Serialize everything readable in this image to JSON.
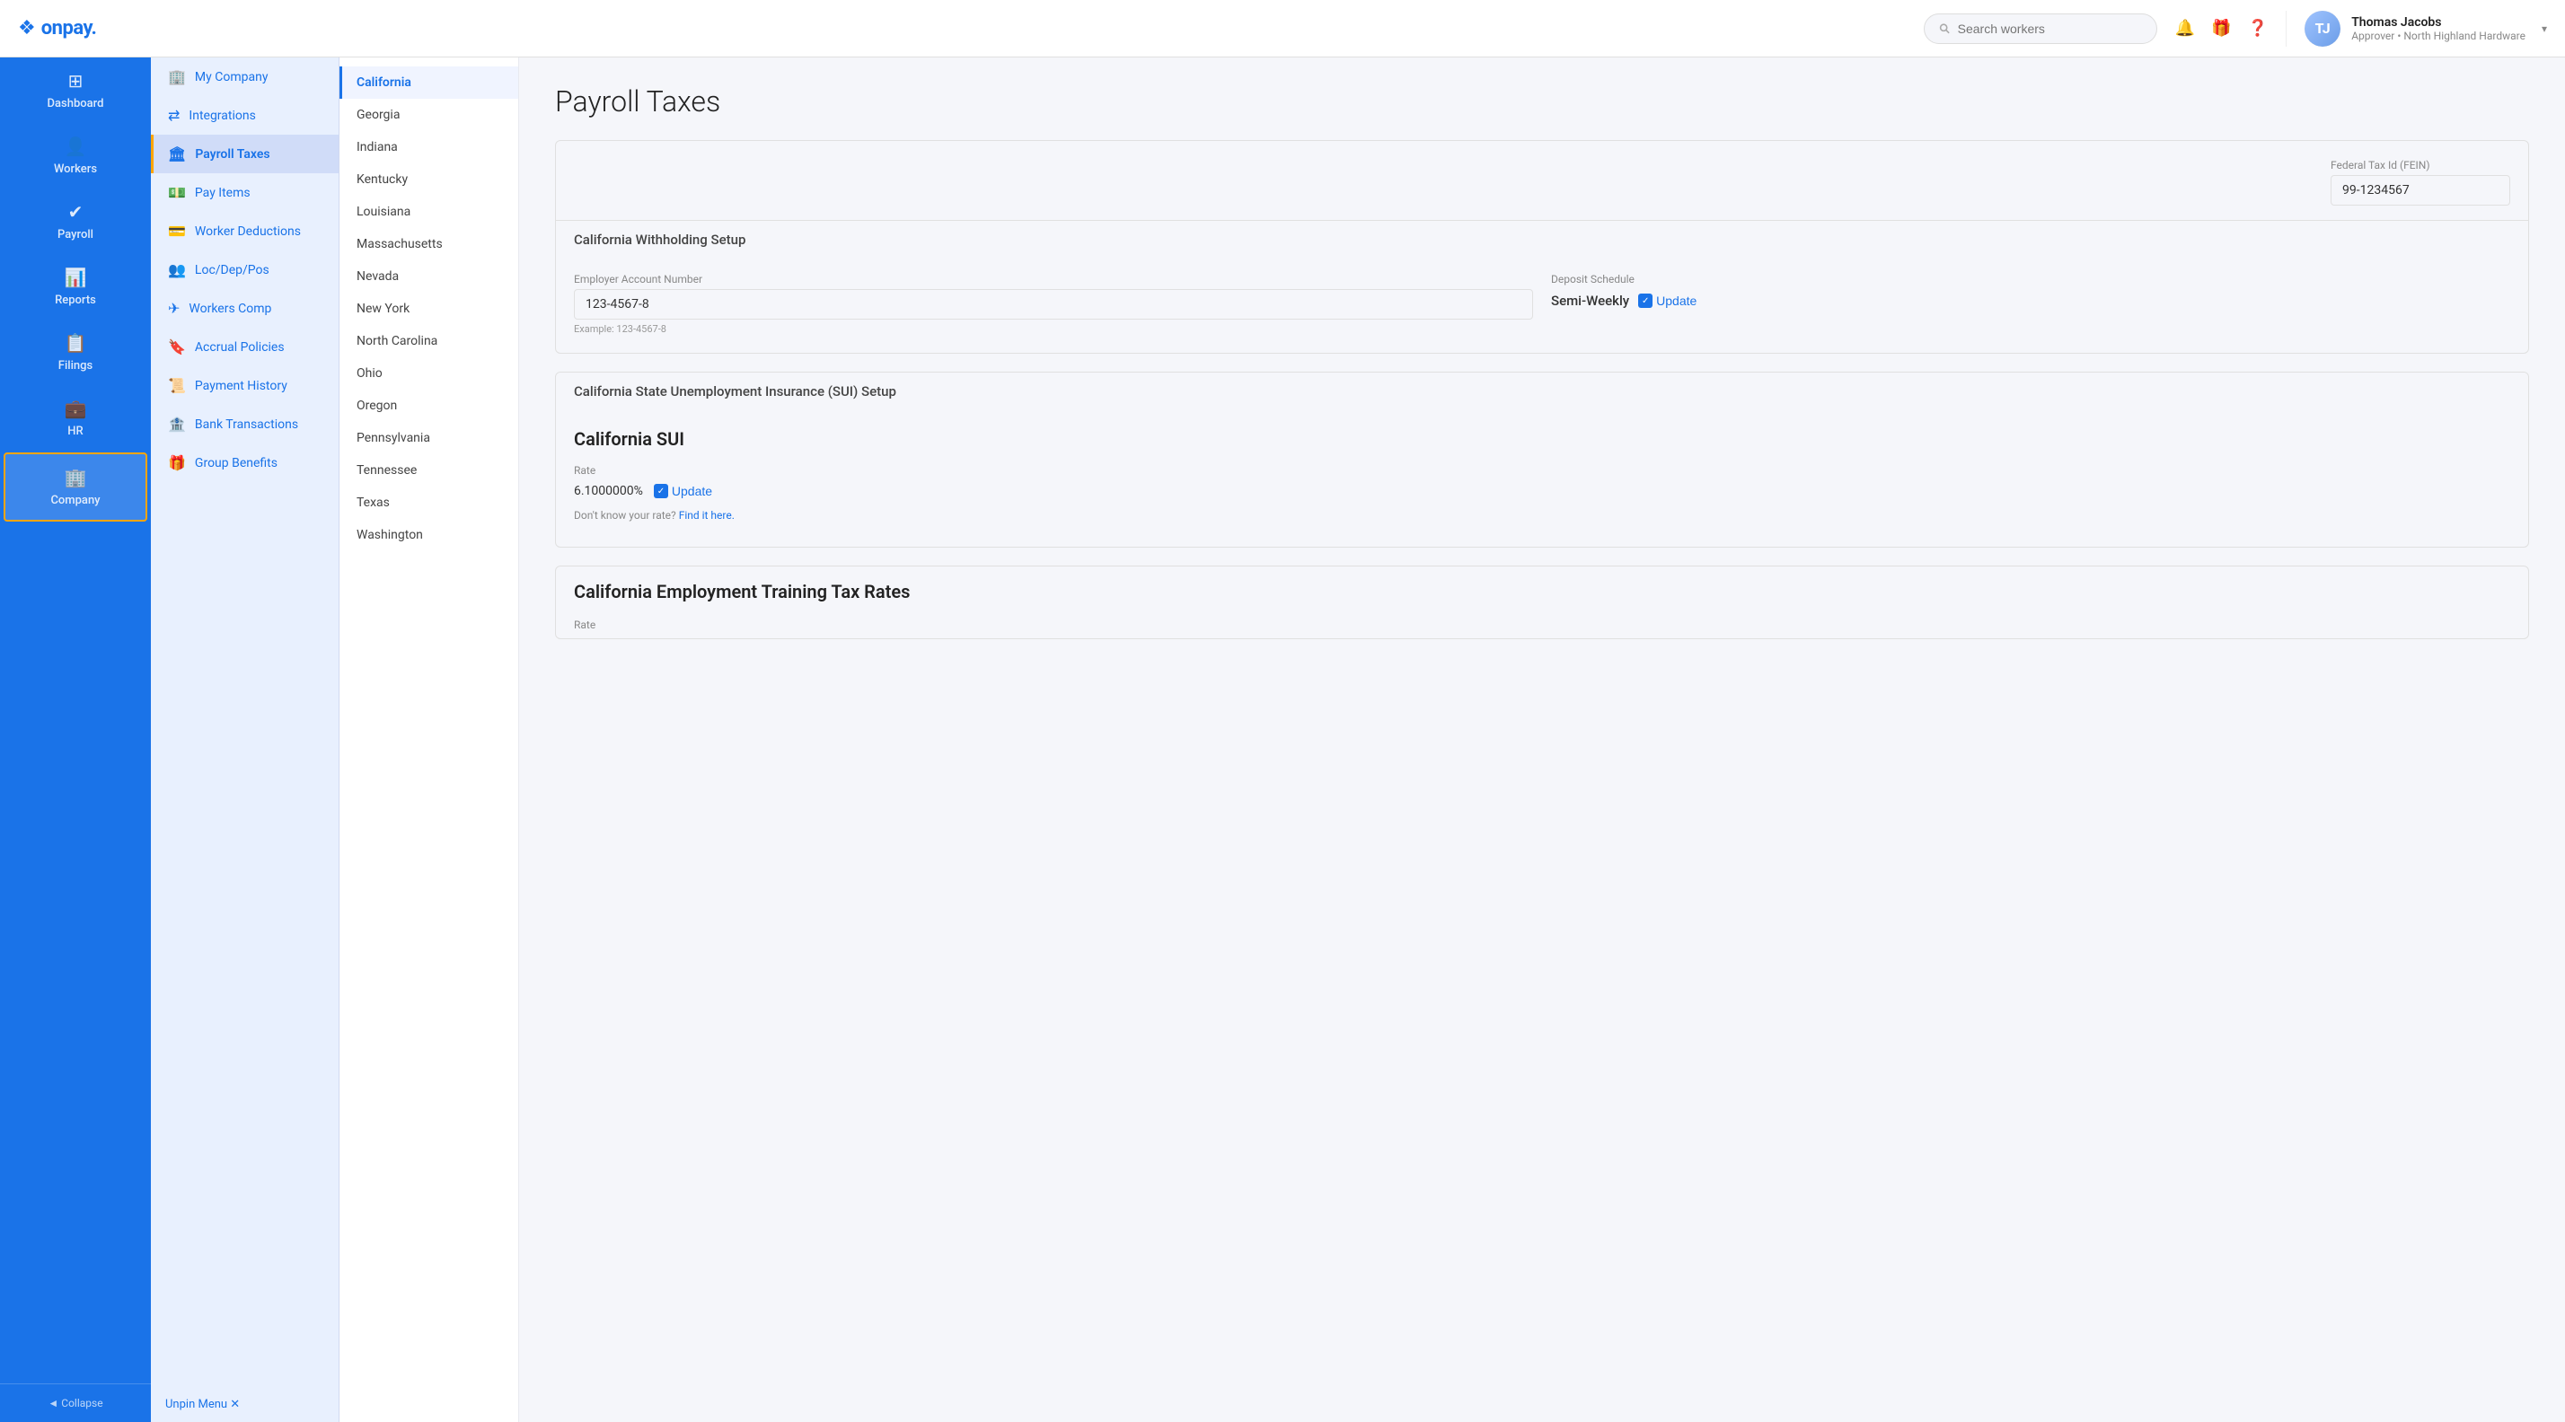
{
  "header": {
    "logo_text": "onpay",
    "logo_symbol": "❖",
    "search_placeholder": "Search workers",
    "user_name": "Thomas Jacobs",
    "user_role": "Approver • North Highland Hardware",
    "user_initials": "TJ"
  },
  "sidebar": {
    "items": [
      {
        "id": "dashboard",
        "label": "Dashboard",
        "icon": "⊞",
        "active": false
      },
      {
        "id": "workers",
        "label": "Workers",
        "icon": "👤",
        "active": false
      },
      {
        "id": "payroll",
        "label": "Payroll",
        "icon": "✔",
        "active": false
      },
      {
        "id": "reports",
        "label": "Reports",
        "icon": "📊",
        "active": false
      },
      {
        "id": "filings",
        "label": "Filings",
        "icon": "📋",
        "active": false
      },
      {
        "id": "hr",
        "label": "HR",
        "icon": "💼",
        "active": false
      },
      {
        "id": "company",
        "label": "Company",
        "icon": "🏢",
        "active": true
      }
    ],
    "collapse_label": "◄ Collapse"
  },
  "sub_sidebar": {
    "items": [
      {
        "id": "my-company",
        "label": "My Company",
        "icon": "🏢"
      },
      {
        "id": "integrations",
        "label": "Integrations",
        "icon": "⇄"
      },
      {
        "id": "payroll-taxes",
        "label": "Payroll Taxes",
        "icon": "🏛",
        "active": true
      },
      {
        "id": "pay-items",
        "label": "Pay Items",
        "icon": "💵"
      },
      {
        "id": "worker-deductions",
        "label": "Worker Deductions",
        "icon": "💳"
      },
      {
        "id": "loc-dep-pos",
        "label": "Loc/Dep/Pos",
        "icon": "👥"
      },
      {
        "id": "workers-comp",
        "label": "Workers Comp",
        "icon": "✈"
      },
      {
        "id": "accrual-policies",
        "label": "Accrual Policies",
        "icon": "🔖"
      },
      {
        "id": "payment-history",
        "label": "Payment History",
        "icon": "📜"
      },
      {
        "id": "bank-transactions",
        "label": "Bank Transactions",
        "icon": "🏦"
      },
      {
        "id": "group-benefits",
        "label": "Group Benefits",
        "icon": "🎁"
      }
    ],
    "unpin_label": "Unpin Menu ✕"
  },
  "page_title": "Payroll Taxes",
  "states": [
    {
      "id": "california",
      "label": "California",
      "active": true
    },
    {
      "id": "georgia",
      "label": "Georgia"
    },
    {
      "id": "indiana",
      "label": "Indiana"
    },
    {
      "id": "kentucky",
      "label": "Kentucky"
    },
    {
      "id": "louisiana",
      "label": "Louisiana"
    },
    {
      "id": "massachusetts",
      "label": "Massachusetts"
    },
    {
      "id": "nevada",
      "label": "Nevada"
    },
    {
      "id": "new-york",
      "label": "New York"
    },
    {
      "id": "north-carolina",
      "label": "North Carolina"
    },
    {
      "id": "ohio",
      "label": "Ohio"
    },
    {
      "id": "oregon",
      "label": "Oregon"
    },
    {
      "id": "pennsylvania",
      "label": "Pennsylvania"
    },
    {
      "id": "tennessee",
      "label": "Tennessee"
    },
    {
      "id": "texas",
      "label": "Texas"
    },
    {
      "id": "washington",
      "label": "Washington"
    }
  ],
  "content": {
    "fein_label": "Federal Tax Id (FEIN)",
    "fein_value": "99-1234567",
    "withholding_section_title": "California Withholding Setup",
    "employer_account_label": "Employer Account Number",
    "employer_account_value": "123-4567-8",
    "employer_account_hint": "Example: 123-4567-8",
    "deposit_schedule_label": "Deposit Schedule",
    "deposit_schedule_value": "Semi-Weekly",
    "deposit_update_label": "Update",
    "sui_section_title": "California State Unemployment Insurance (SUI) Setup",
    "sui_title": "California SUI",
    "rate_label": "Rate",
    "rate_value": "6.1000000%",
    "rate_update_label": "Update",
    "dont_know_text": "Don't know your rate?",
    "find_here_text": "Find it here.",
    "employment_tax_title": "California Employment Training Tax Rates",
    "employment_rate_label": "Rate"
  }
}
